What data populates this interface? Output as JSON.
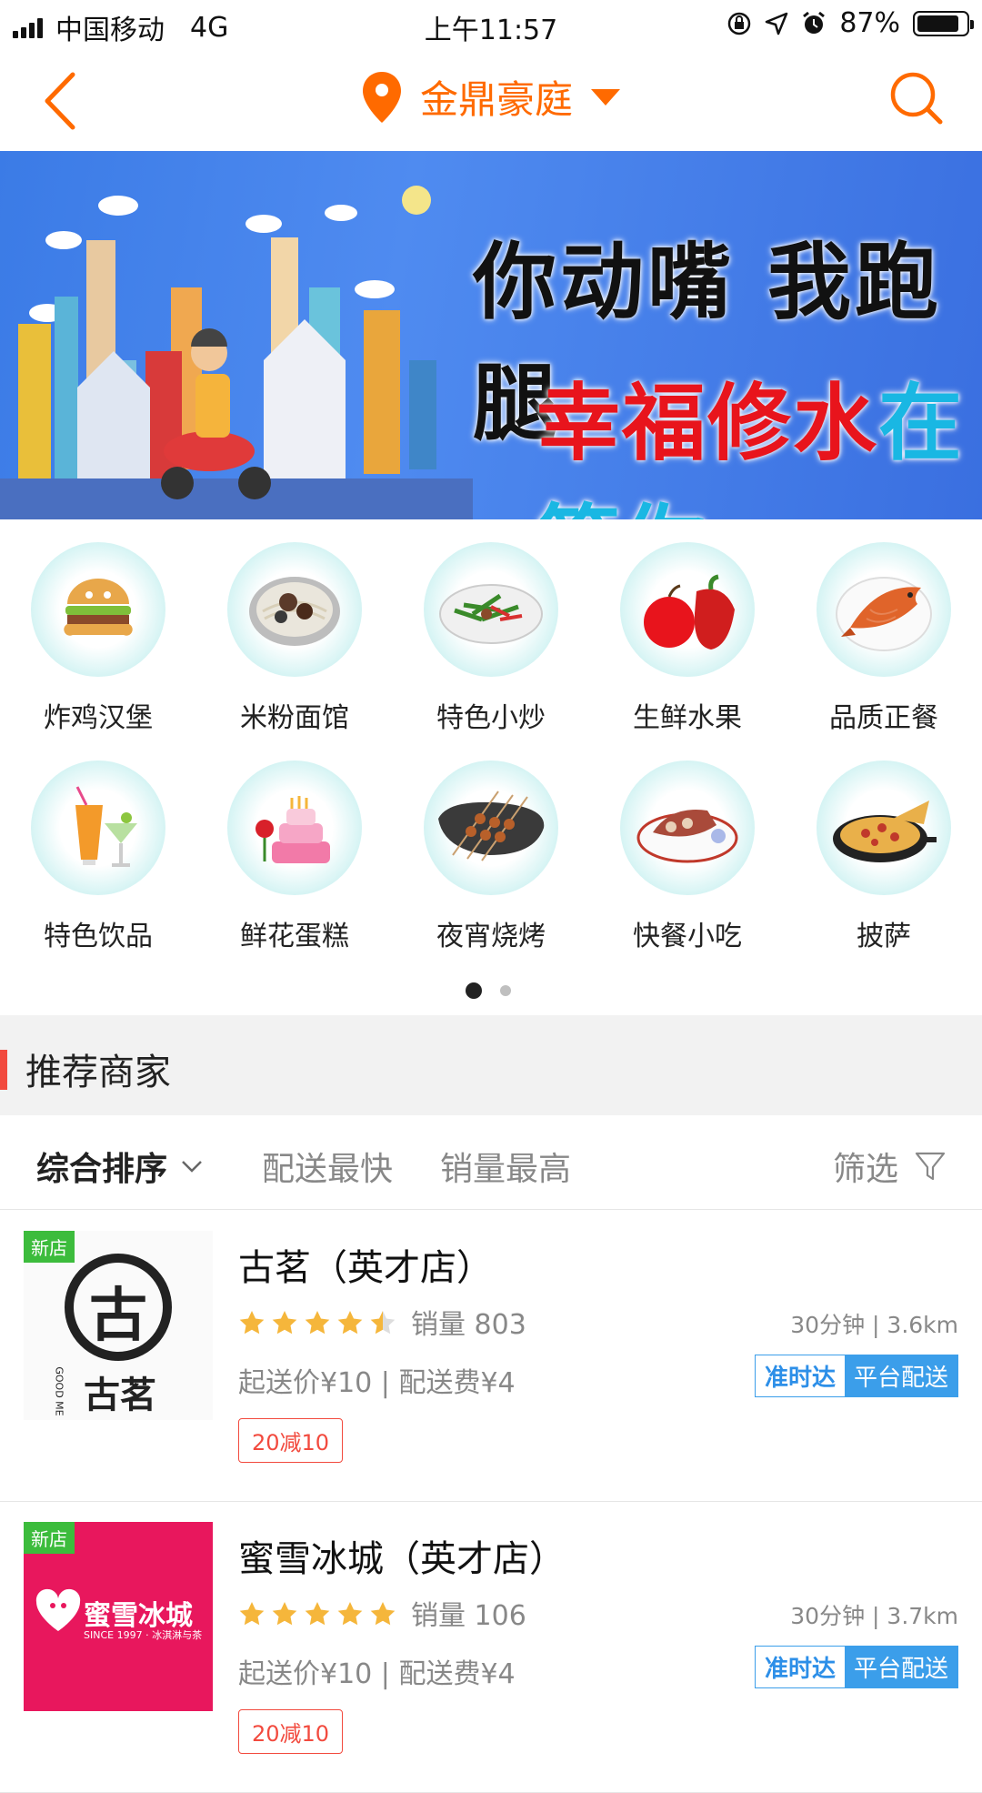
{
  "status_bar": {
    "carrier": "中国移动",
    "network": "4G",
    "time": "上午11:57",
    "battery": "87%",
    "battery_level": 0.87
  },
  "nav": {
    "location": "金鼎豪庭"
  },
  "banner": {
    "title": "你动嘴 我跑腿",
    "sub_red": "幸福修水",
    "sub_cyan": "在等你",
    "page_count": 2,
    "active_page": 0
  },
  "categories": [
    {
      "label": "炸鸡汉堡",
      "icon": "burger-icon"
    },
    {
      "label": "米粉面馆",
      "icon": "noodle-bowl-icon"
    },
    {
      "label": "特色小炒",
      "icon": "stir-fry-icon"
    },
    {
      "label": "生鲜水果",
      "icon": "fruit-icon"
    },
    {
      "label": "品质正餐",
      "icon": "fish-dish-icon"
    },
    {
      "label": "特色饮品",
      "icon": "drinks-icon"
    },
    {
      "label": "鲜花蛋糕",
      "icon": "cake-icon"
    },
    {
      "label": "夜宵烧烤",
      "icon": "skewer-icon"
    },
    {
      "label": "快餐小吃",
      "icon": "snack-plate-icon"
    },
    {
      "label": "披萨",
      "icon": "pizza-icon"
    }
  ],
  "section": {
    "title": "推荐商家"
  },
  "sort": {
    "comprehensive": "综合排序",
    "fastest": "配送最快",
    "sales": "销量最高",
    "filter": "筛选"
  },
  "shops": [
    {
      "tag": "新店",
      "name": "古茗（英才店）",
      "rating": 4.5,
      "sales": "销量 803",
      "fees": "起送价¥10 | 配送费¥4",
      "time_distance": "30分钟 | 3.6km",
      "badge_ontime": "准时达",
      "badge_platform": "平台配送",
      "promo": "20减10",
      "logo_text": "古茗",
      "logo_mark": "古",
      "logo_side": "GOOD ME"
    },
    {
      "tag": "新店",
      "name": "蜜雪冰城（英才店）",
      "rating": 5,
      "sales": "销量 106",
      "fees": "起送价¥10 | 配送费¥4",
      "time_distance": "30分钟 | 3.7km",
      "badge_ontime": "准时达",
      "badge_platform": "平台配送",
      "promo": "20减10",
      "logo_text": "蜜雪冰城",
      "logo_sub": "SINCE 1997 · 冰淇淋与茶"
    }
  ],
  "colors": {
    "accent": "#ff6a00",
    "section_bar": "#f24a3e",
    "new_tag": "#3cbc3c",
    "badge_blue": "#3b9eea",
    "star": "#f5b63b"
  }
}
